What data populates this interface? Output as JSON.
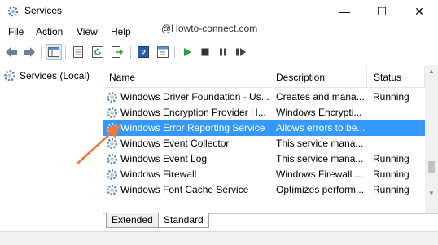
{
  "window": {
    "title": "Services",
    "minimize": "—",
    "maximize": "☐",
    "close": "✕"
  },
  "menu": [
    "File",
    "Action",
    "View",
    "Help"
  ],
  "watermark": "@Howto-connect.com",
  "toolbar": {
    "icons": [
      "back-icon",
      "forward-icon",
      "console-tree-icon",
      "properties-icon",
      "refresh-icon",
      "export-icon",
      "help-icon",
      "console-icon",
      "start-icon",
      "stop-icon",
      "pause-icon",
      "restart-icon"
    ]
  },
  "tree": {
    "root_label": "Services (Local)"
  },
  "list": {
    "columns": [
      "Name",
      "Description",
      "Status"
    ],
    "rows": [
      {
        "name": "Windows Driver Foundation - Us...",
        "description": "Creates and mana...",
        "status": "Running"
      },
      {
        "name": "Windows Encryption Provider H...",
        "description": "Windows Encrypti...",
        "status": ""
      },
      {
        "name": "Windows Error Reporting Service",
        "description": "Allows errors to be...",
        "status": ""
      },
      {
        "name": "Windows Event Collector",
        "description": "This service mana...",
        "status": ""
      },
      {
        "name": "Windows Event Log",
        "description": "This service mana...",
        "status": "Running"
      },
      {
        "name": "Windows Firewall",
        "description": "Windows Firewall ...",
        "status": "Running"
      },
      {
        "name": "Windows Font Cache Service",
        "description": "Optimizes perform...",
        "status": "Running"
      }
    ],
    "selected_index": 2
  },
  "tabs": [
    "Extended",
    "Standard"
  ],
  "active_tab": "Standard",
  "colors": {
    "selection": "#3399ff",
    "arrow": "#f07830",
    "play_green": "#2e9e3a"
  }
}
